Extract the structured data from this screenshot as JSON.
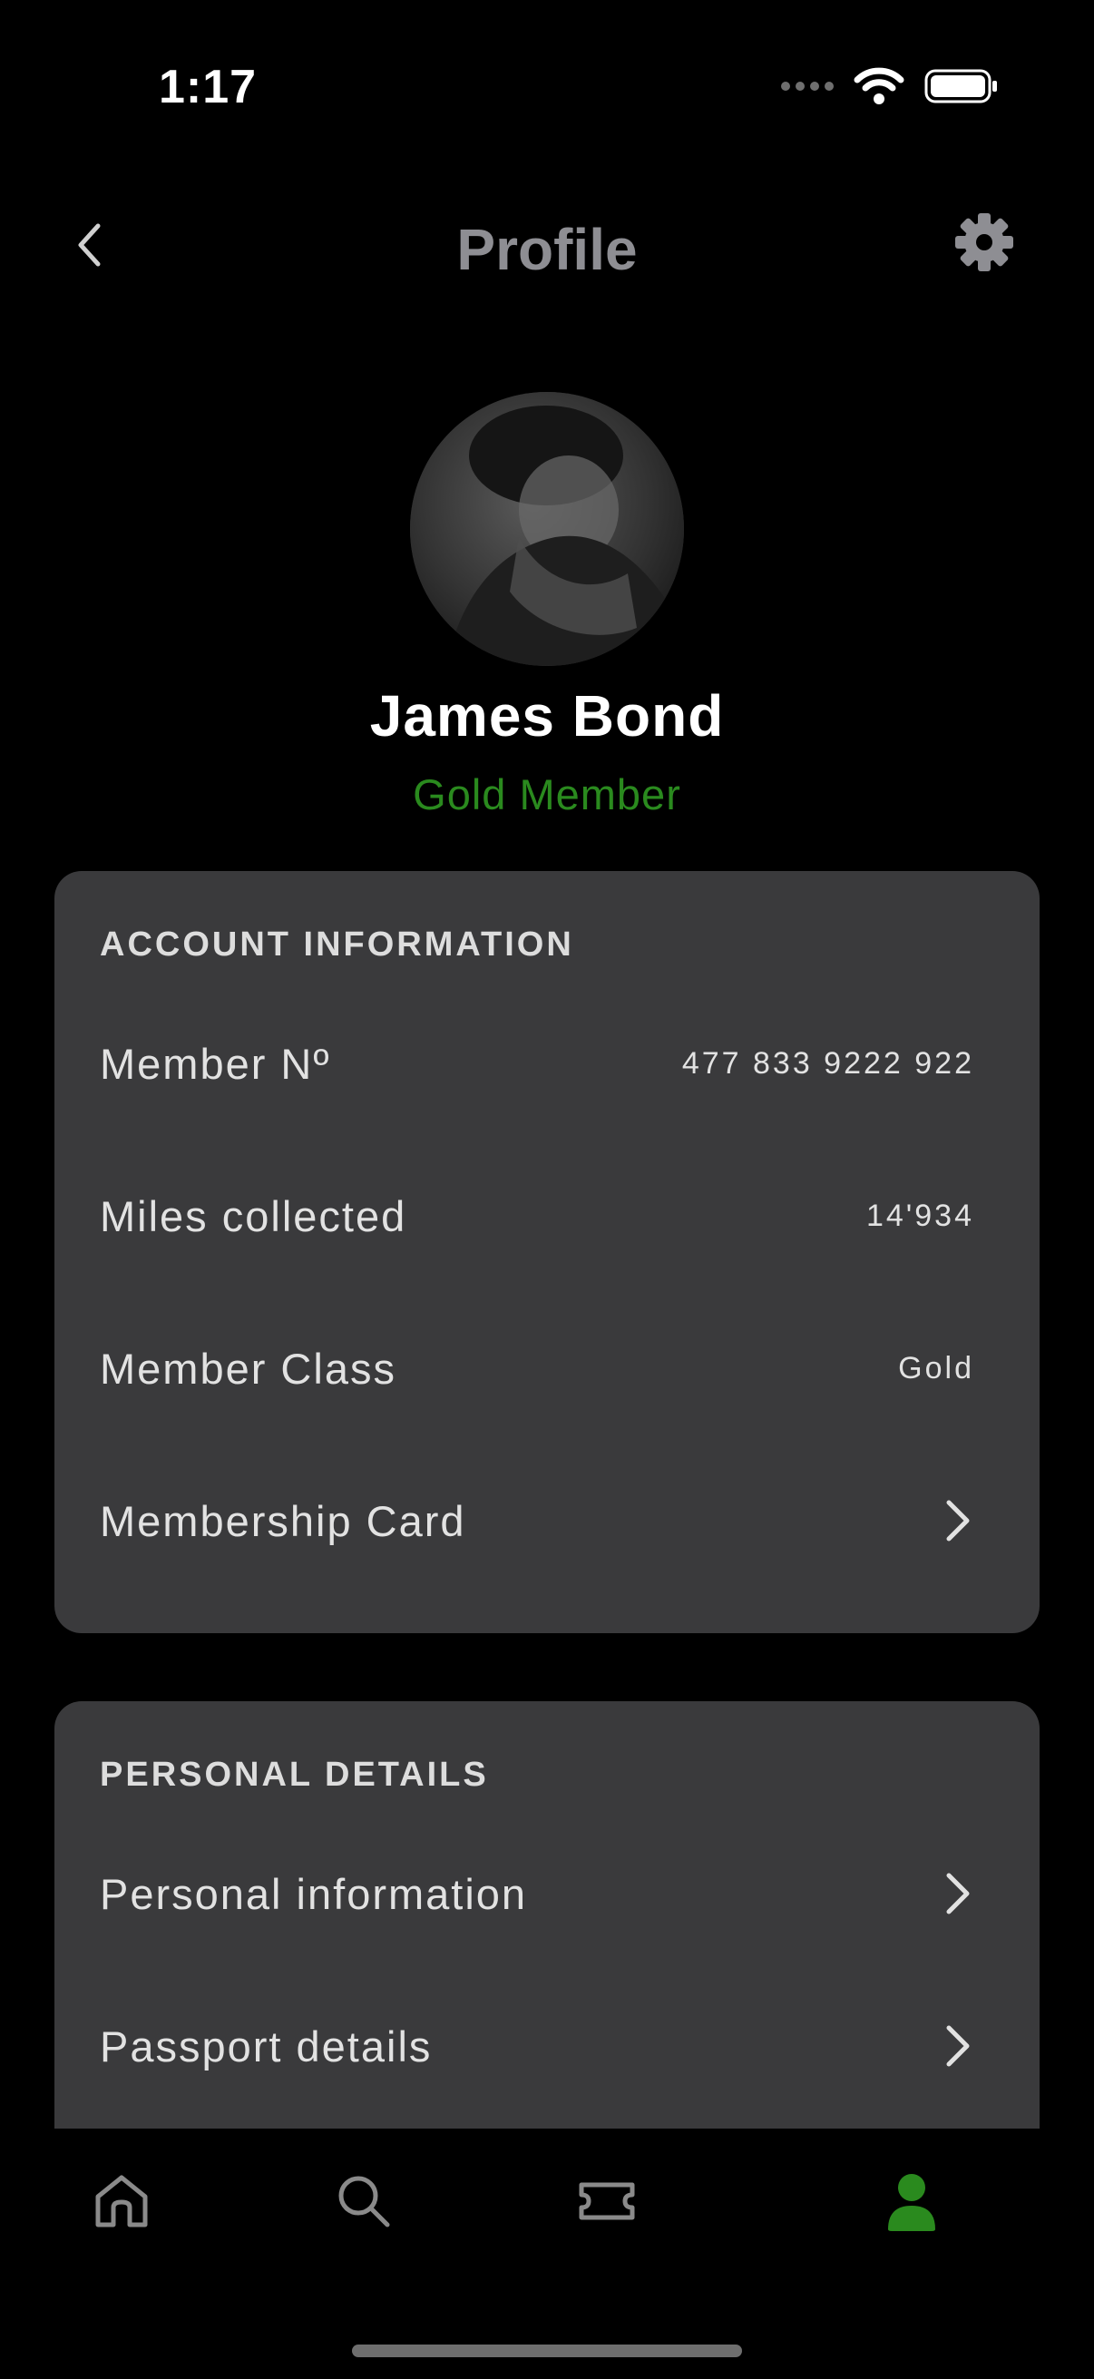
{
  "status": {
    "time": "1:17"
  },
  "nav": {
    "title": "Profile"
  },
  "profile": {
    "name": "James Bond",
    "tier": "Gold Member"
  },
  "account": {
    "heading": "ACCOUNT INFORMATION",
    "rows": [
      {
        "label": "Member Nº",
        "value": "477 833 9222 922"
      },
      {
        "label": "Miles collected",
        "value": "14'934"
      },
      {
        "label": "Member Class",
        "value": "Gold"
      },
      {
        "label": "Membership Card"
      }
    ]
  },
  "personal": {
    "heading": "PERSONAL DETAILS",
    "rows": [
      {
        "label": "Personal information"
      },
      {
        "label": "Passport details"
      }
    ]
  },
  "tabs": [
    "home-icon",
    "search-icon",
    "ticket-icon",
    "profile-icon"
  ],
  "colors": {
    "accent": "#2a8a1e",
    "card": "#3a3a3c",
    "title": "#8e8e93"
  }
}
